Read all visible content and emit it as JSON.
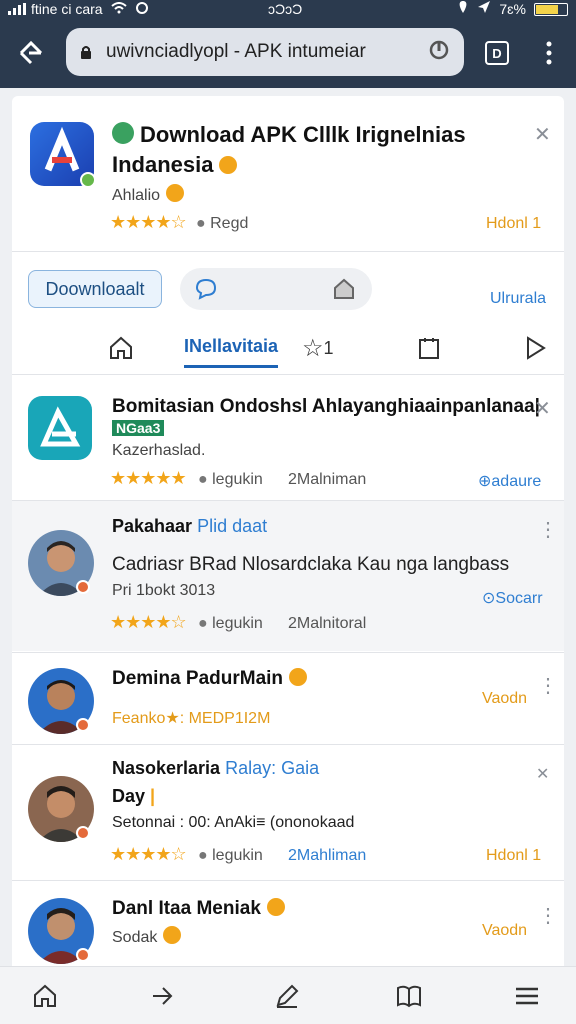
{
  "status_bar": {
    "carrier": "ftine ci cara",
    "time": "ɔƆɔƆ",
    "battery": "7ɛ%"
  },
  "browser": {
    "url": "uwivnciadlyopl - APK intumeiar",
    "tab_count": "D"
  },
  "app_header": {
    "title_line1": "Download APK Clllk Irignelnias",
    "title_line2": "Indanesia",
    "developer": "Ahlalio",
    "stars": "★★★★☆",
    "rating_label": "Regd",
    "action": "Hdonl 1"
  },
  "actions": {
    "download_label": "Doownloaalt",
    "side_link": "Ulrurala"
  },
  "tabs": [
    {
      "label": ""
    },
    {
      "label": "INellavitaia"
    },
    {
      "label": "1"
    },
    {
      "label": ""
    },
    {
      "label": ""
    }
  ],
  "items": [
    {
      "title": "Bomitasian Ondoshsl Ahlayanghiaainpanlanaa|",
      "badge": "NGaa3",
      "subtitle": "Kazerhaslad.",
      "stars": "★★★★★",
      "meta1": "legukin",
      "meta2": "2Malniman",
      "action": "adaure"
    },
    {
      "title": "Pakahaar",
      "title_accent": "Plid daat",
      "body": "Cadriasr BRad Nlosardclaka  Kau nga langbass",
      "subtitle": "Pri 1bokt 3013",
      "stars": "★★★★☆",
      "meta1": "legukin",
      "meta2": "2Malnitoral",
      "action": "Socarr"
    },
    {
      "title": "Demina PadurMain",
      "meta": "Feanko★: MEDP1I2M",
      "action": "Vaodn"
    },
    {
      "title": "Nasokerlaria",
      "title_accent": "Ralay: Gaia",
      "title_line2": "Day",
      "meta": "Setonnai : 00: AnAki≡ (ononokaad",
      "stars": "★★★★☆",
      "meta1": "legukin",
      "meta2": "2Mahliman",
      "action": "Hdonl 1"
    },
    {
      "title": "Danl Itaa Meniak",
      "subtitle": "Sodak",
      "action": "Vaodn"
    }
  ],
  "colors": {
    "status_bg": "#2b3a4e",
    "accent_blue": "#1c63b5",
    "star": "#f2a51a",
    "action_orange": "#e39b1a"
  }
}
